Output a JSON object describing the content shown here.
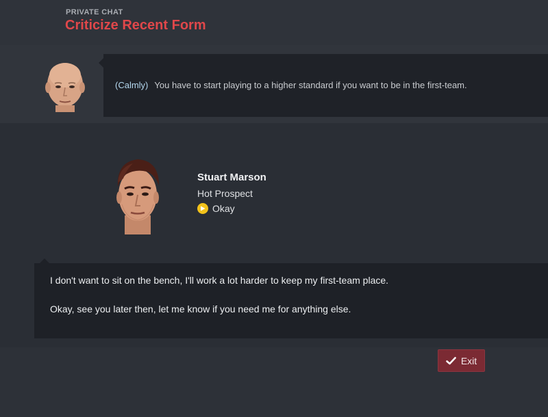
{
  "header": {
    "kicker": "PRIVATE CHAT",
    "title": "Criticize Recent Form"
  },
  "manager": {
    "tone": "(Calmly)",
    "message": "You have to start playing to a higher standard if you want to be in the first-team."
  },
  "player": {
    "name": "Stuart Marson",
    "role": "Hot Prospect",
    "status": "Okay",
    "status_color": "#f2c21b"
  },
  "responses": [
    "I don't want to sit on the bench, I'll work a lot harder to keep my first-team place.",
    "Okay, see you later then, let me know if you need me for anything else."
  ],
  "actions": {
    "exit_label": "Exit",
    "exit_icon": "check-icon",
    "exit_color": "#7b2a33"
  },
  "colors": {
    "accent": "#e0474a",
    "background": "#2a2e35"
  }
}
